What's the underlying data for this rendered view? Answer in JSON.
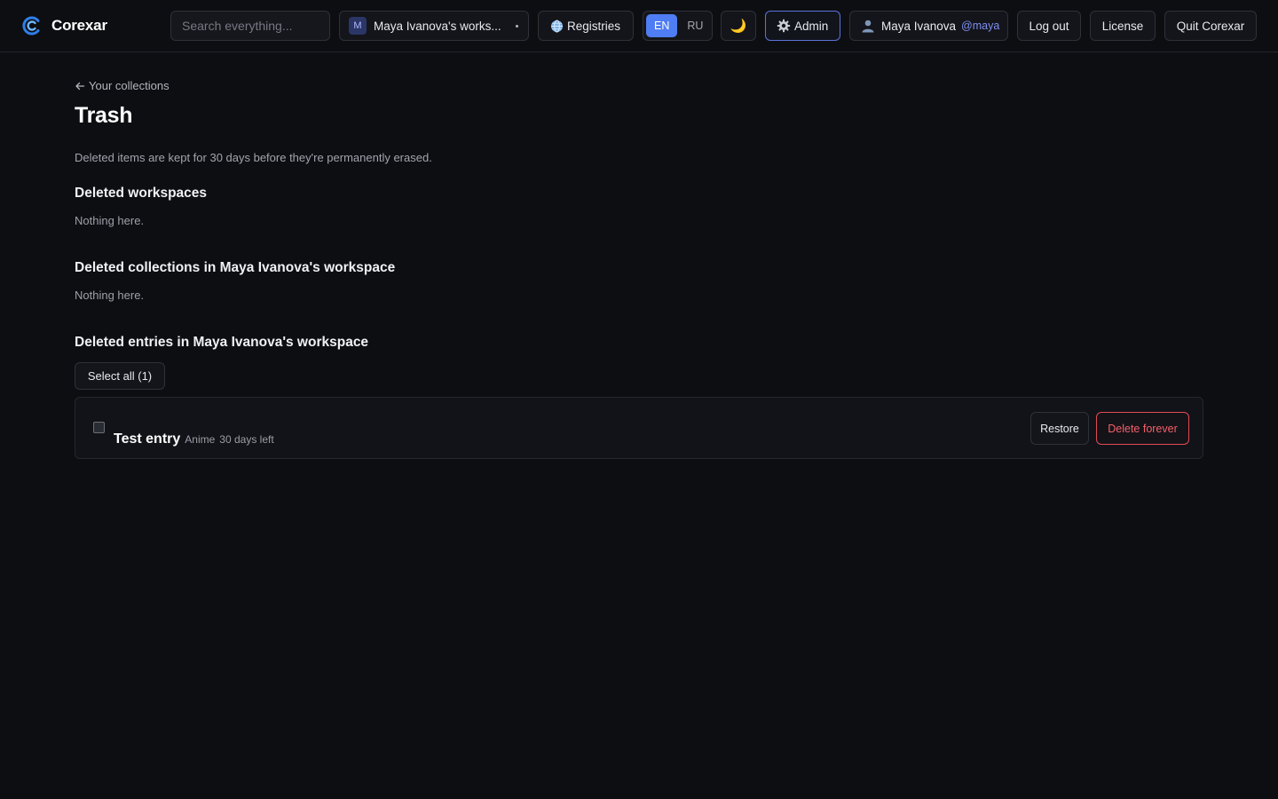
{
  "app": {
    "name": "Corexar",
    "logo_icon": "corexar-logo-icon",
    "accent_color": "#4f7df3"
  },
  "topbar": {
    "search_placeholder": "Search everything...",
    "workspace": {
      "avatar_letter": "M",
      "name": "Maya Ivanova's works..."
    },
    "registries_label": "Registries",
    "languages": [
      {
        "code": "EN",
        "active": true
      },
      {
        "code": "RU",
        "active": false
      }
    ],
    "theme_icon": "🌙",
    "admin_label": "Admin",
    "user": {
      "name": "Maya Ivanova",
      "handle": "@maya"
    },
    "logout_label": "Log out",
    "license_label": "License",
    "quit_label": "Quit Corexar"
  },
  "page": {
    "back_label": "Your collections",
    "title": "Trash",
    "description": "Deleted items are kept for 30 days before they're permanently erased.",
    "sections": {
      "workspaces": {
        "heading": "Deleted workspaces",
        "empty_text": "Nothing here."
      },
      "collections": {
        "heading": "Deleted collections in Maya Ivanova's workspace",
        "empty_text": "Nothing here."
      },
      "entries": {
        "heading": "Deleted entries in Maya Ivanova's workspace",
        "select_all_label": "Select all (1)",
        "items": [
          {
            "title": "Test entry",
            "collection": "Anime",
            "days_left": "30 days left",
            "restore_label": "Restore",
            "delete_label": "Delete forever",
            "checked": false
          }
        ]
      }
    }
  }
}
